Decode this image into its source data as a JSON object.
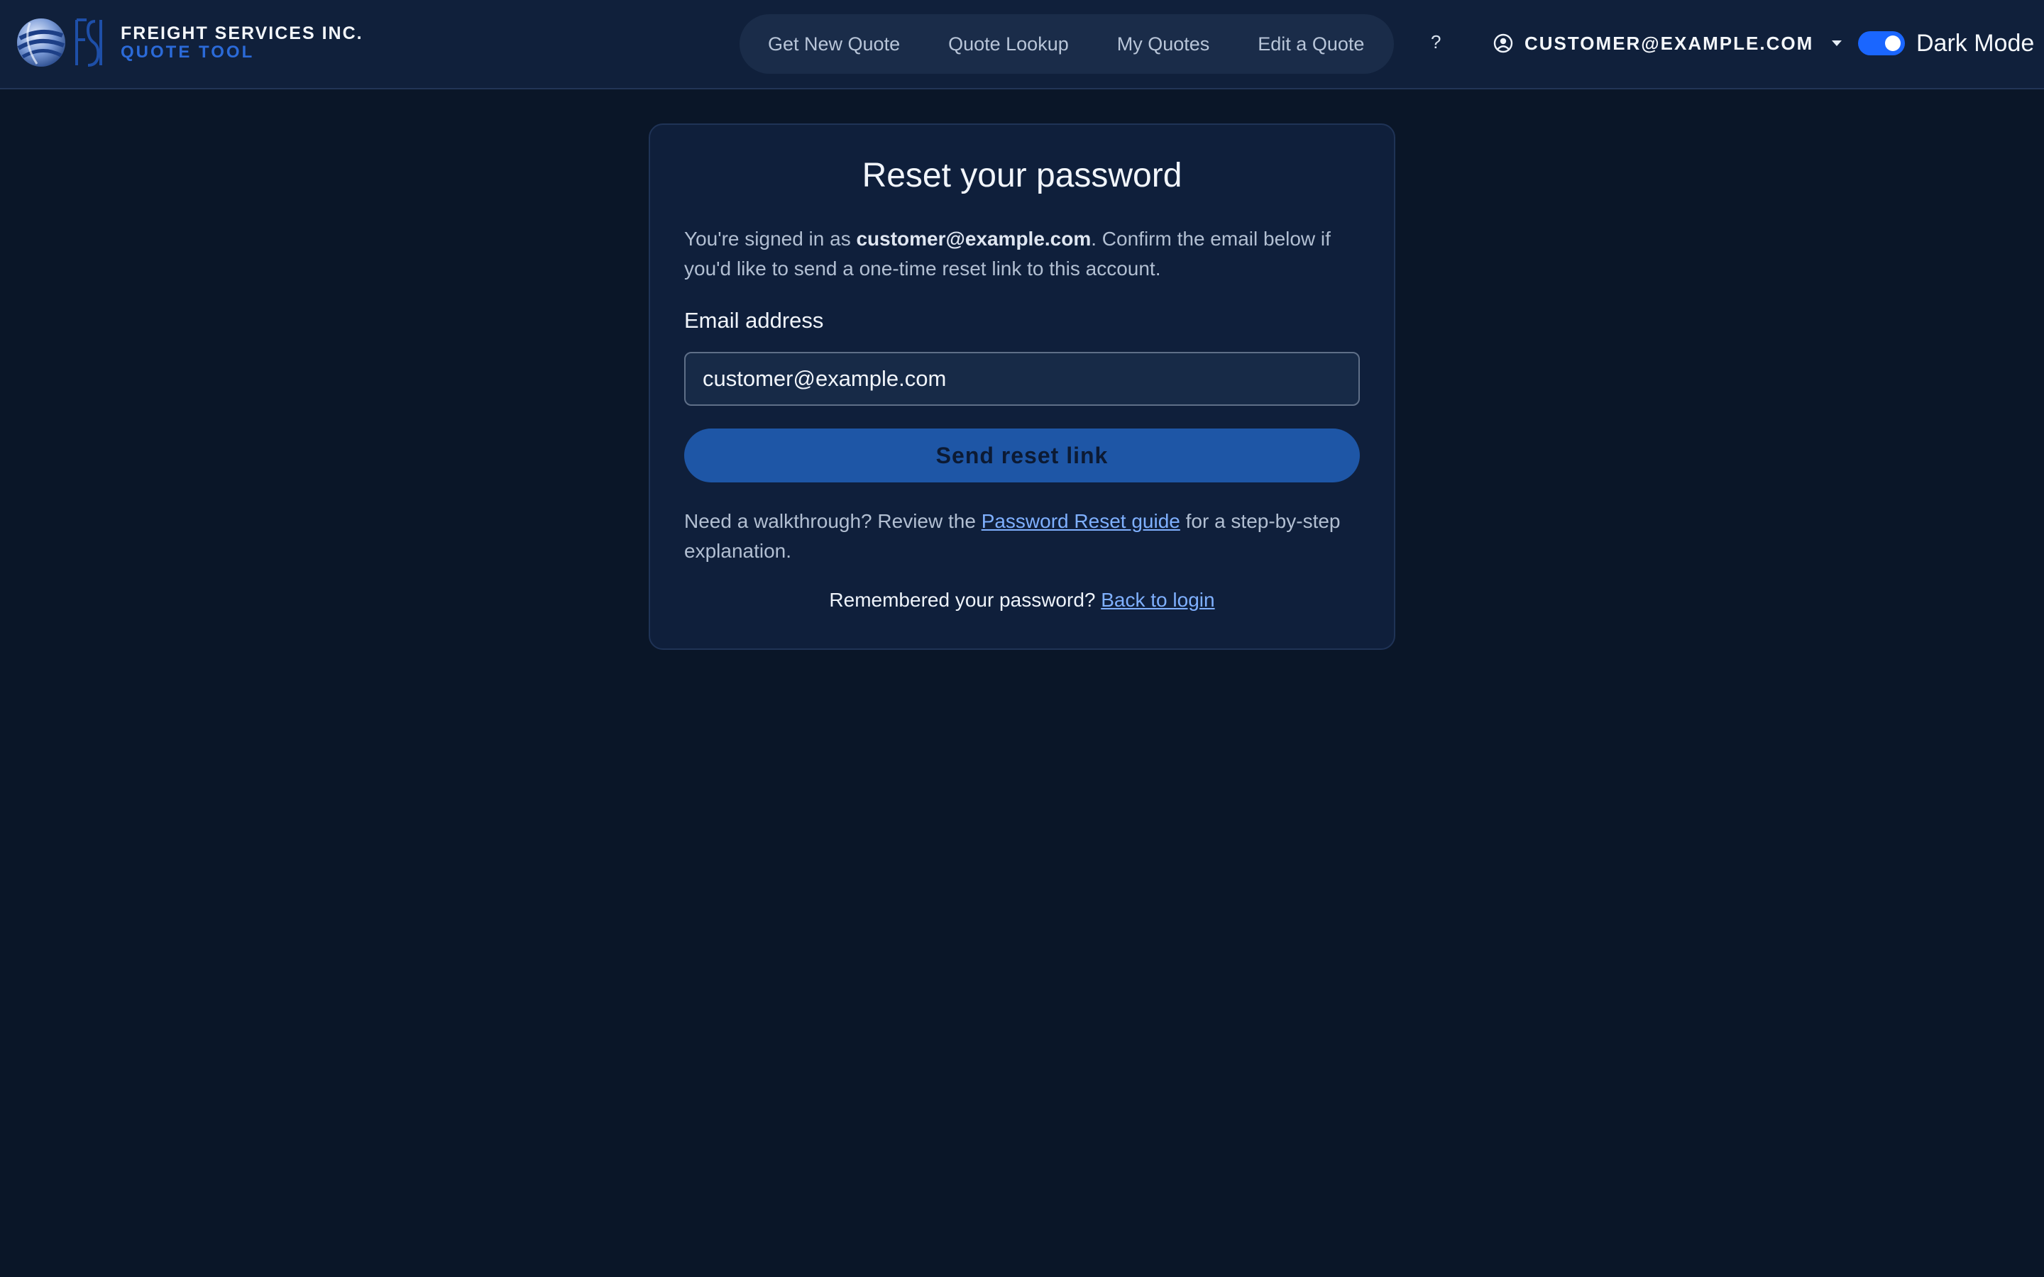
{
  "header": {
    "brand_name": "FREIGHT SERVICES INC.",
    "brand_sub": "QUOTE TOOL",
    "nav": [
      {
        "label": "Get New Quote"
      },
      {
        "label": "Quote Lookup"
      },
      {
        "label": "My Quotes"
      },
      {
        "label": "Edit a Quote"
      }
    ],
    "help_label": "?",
    "user_email": "CUSTOMER@EXAMPLE.COM",
    "user_icon": "user-circle-icon",
    "dark_mode": {
      "label": "Dark Mode",
      "enabled": true
    }
  },
  "reset_form": {
    "title": "Reset your password",
    "intro_prefix": "You're signed in as ",
    "intro_email": "customer@example.com",
    "intro_suffix": ". Confirm the email below if you'd like to send a one-time reset link to this account.",
    "email_label": "Email address",
    "email_value": "customer@example.com",
    "submit_label": "Send reset link",
    "walkthrough_prefix": "Need a walkthrough? Review the ",
    "walkthrough_link": "Password Reset guide",
    "walkthrough_suffix": " for a step-by-step explanation.",
    "remember_prefix": "Remembered your password? ",
    "remember_link": "Back to login"
  },
  "colors": {
    "page_background": "#0a1628",
    "header_background": "#10203b",
    "card_background": "#0f1f3b",
    "accent": "#1a66ff",
    "button": "#1e56a6",
    "link": "#7fb0ff"
  }
}
